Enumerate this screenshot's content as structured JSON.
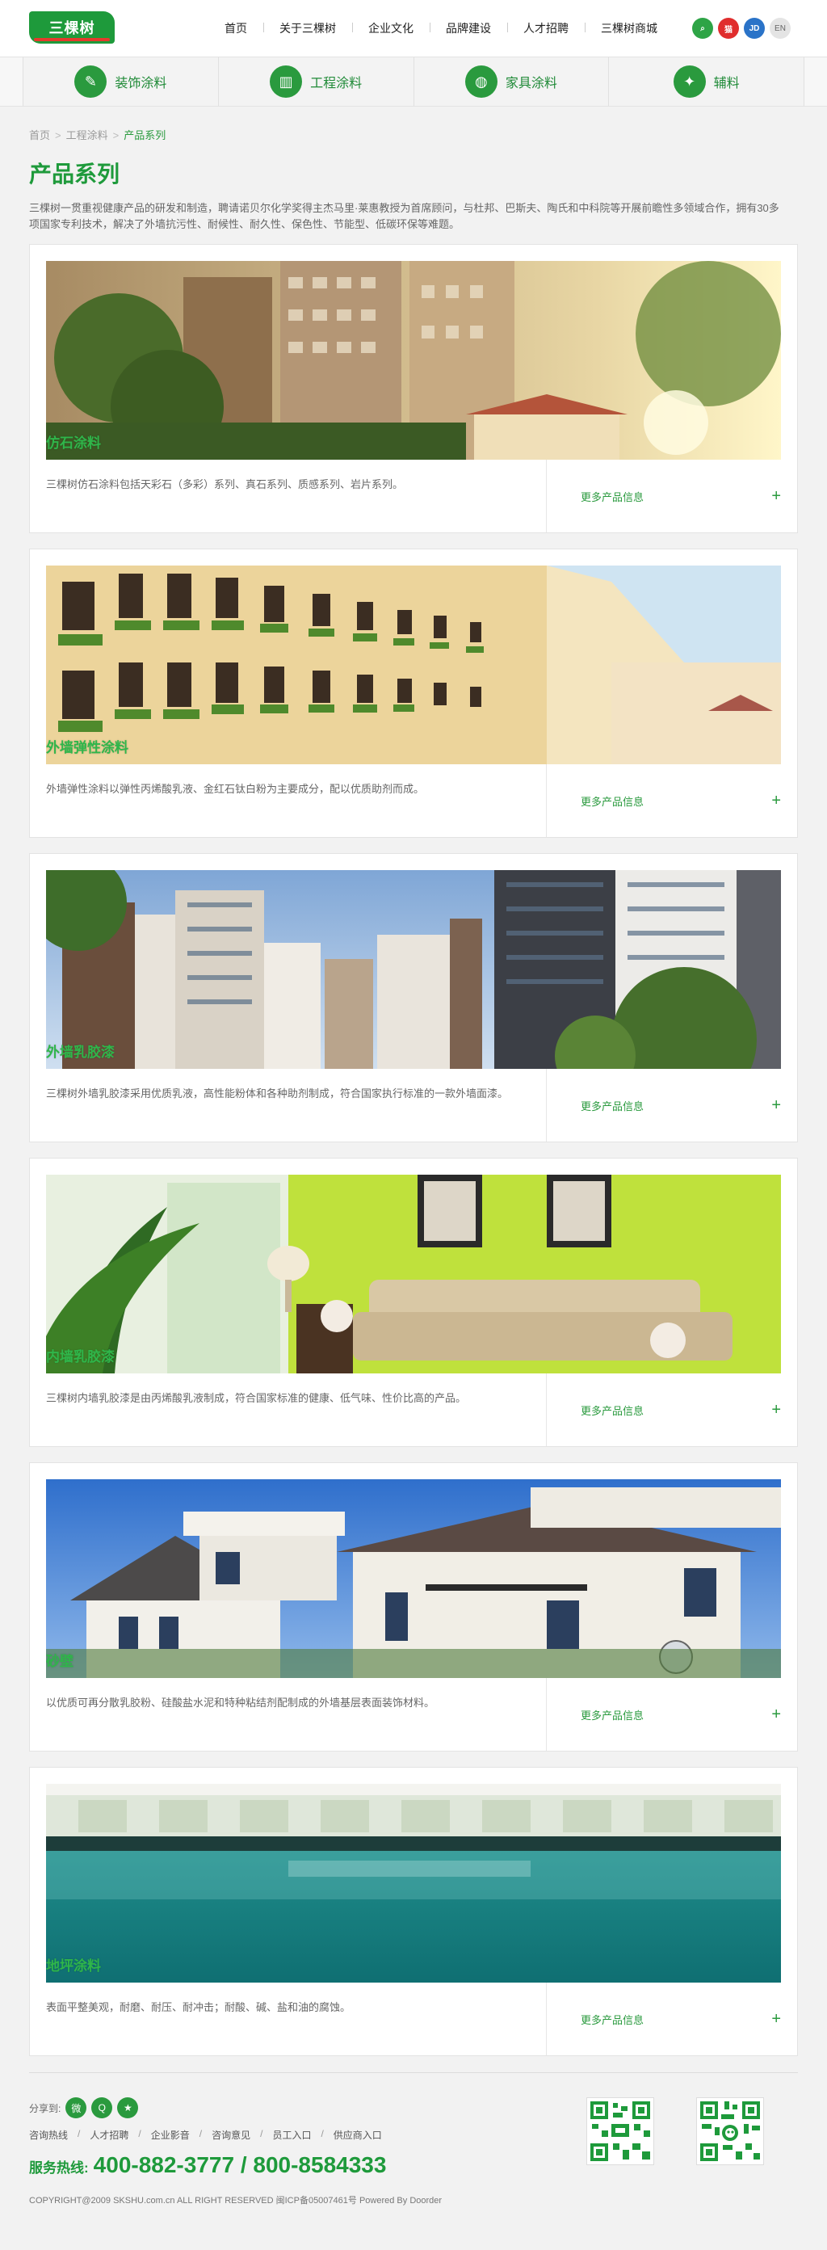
{
  "header": {
    "logo_text": "三棵树",
    "nav": [
      "首页",
      "关于三棵树",
      "企业文化",
      "品牌建设",
      "人才招聘",
      "三棵树商城"
    ],
    "util": {
      "search_glyph": "⌕",
      "tmall": "猫",
      "jd": "JD",
      "en": "EN"
    }
  },
  "categories": [
    {
      "label": "装饰涂料",
      "icon": "brush-icon",
      "glyph": "✎"
    },
    {
      "label": "工程涂料",
      "icon": "building-icon",
      "glyph": "▥"
    },
    {
      "label": "家具涂料",
      "icon": "paint-can-icon",
      "glyph": "◍"
    },
    {
      "label": "辅料",
      "icon": "tool-icon",
      "glyph": "✦"
    }
  ],
  "breadcrumb": {
    "items": [
      "首页",
      "工程涂料"
    ],
    "current": "产品系列",
    "sep": ">"
  },
  "page": {
    "title": "产品系列",
    "intro": "三棵树一贯重视健康产品的研发和制造，聘请诺贝尔化学奖得主杰马里·莱惠教授为首席顾问，与杜邦、巴斯夫、陶氏和中科院等开展前瞻性多领域合作，拥有30多项国家专利技术，解决了外墙抗污性、耐候性、耐久性、保色性、节能型、低碳环保等难题。"
  },
  "more_label": "更多产品信息",
  "plus": "+",
  "products": [
    {
      "name": "仿石涂料",
      "desc": "三棵树仿石涂料包括天彩石（多彩）系列、真石系列、质感系列、岩片系列。"
    },
    {
      "name": "外墙弹性涂料",
      "desc": "外墙弹性涂料以弹性丙烯酸乳液、金红石钛白粉为主要成分，配以优质助剂而成。"
    },
    {
      "name": "外墙乳胶漆",
      "desc": "三棵树外墙乳胶漆采用优质乳液，高性能粉体和各种助剂制成，符合国家执行标准的一款外墙面漆。"
    },
    {
      "name": "内墙乳胶漆",
      "desc": "三棵树内墙乳胶漆是由丙烯酸乳液制成，符合国家标准的健康、低气味、性价比高的产品。"
    },
    {
      "name": "砂壁",
      "desc": "以优质可再分散乳胶粉、硅酸盐水泥和特种粘结剂配制成的外墙基层表面装饰材料。"
    },
    {
      "name": "地坪涂料",
      "desc": "表面平整美观，耐磨、耐压、耐冲击；耐酸、碱、盐和油的腐蚀。"
    }
  ],
  "footer": {
    "share_label": "分享到:",
    "share_icons": [
      {
        "name": "weibo-share-icon",
        "glyph": "微"
      },
      {
        "name": "qq-share-icon",
        "glyph": "Q"
      },
      {
        "name": "star-share-icon",
        "glyph": "★"
      }
    ],
    "links": [
      "咨询热线",
      "人才招聘",
      "企业影音",
      "咨询意见",
      "员工入口",
      "供应商入口"
    ],
    "link_sep": "/",
    "hotline_label": "服务热线:",
    "hotline_number": "400-882-3777 / 800-8584333",
    "copyright": "COPYRIGHT@2009 SKSHU.com.cn ALL RIGHT RESERVED 闽ICP备05007461号    Powered By Doorder"
  },
  "colors": {
    "brand_green": "#1e9a3b",
    "accent_red": "#e43b2c"
  }
}
